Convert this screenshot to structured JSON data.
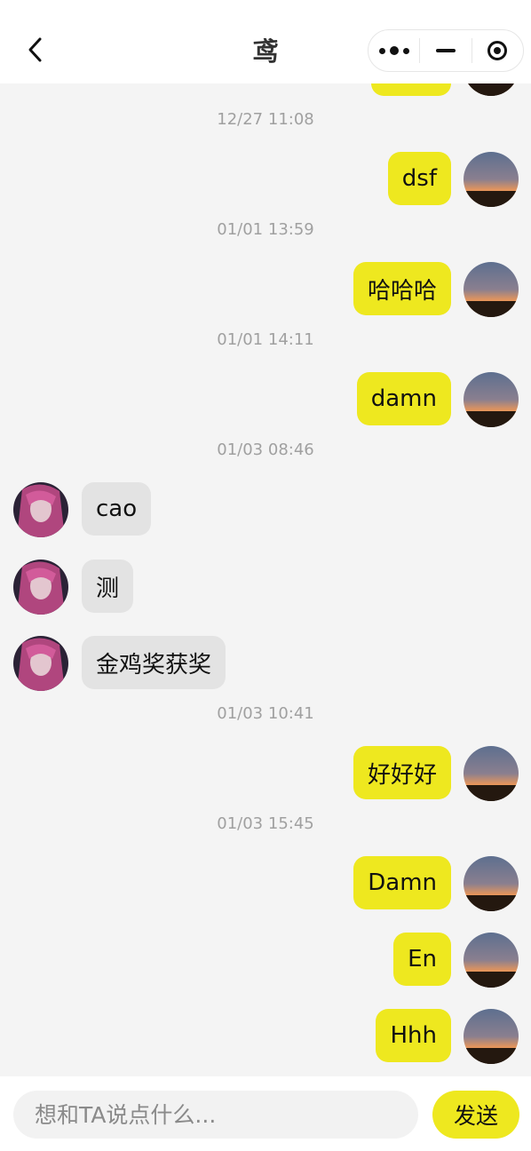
{
  "header": {
    "title": "鸢",
    "back_icon": "chevron-left-icon",
    "capsule": [
      "more-dots-icon",
      "minimize-icon",
      "close-target-icon"
    ]
  },
  "colors": {
    "my_bubble": "#eee81f",
    "other_bubble": "#e3e3e3",
    "timestamp": "#a0a0a0",
    "background": "#f4f4f4"
  },
  "messages": {
    "ts1": "12/27 11:08",
    "m1": "dsf",
    "ts2": "01/01 13:59",
    "m2": "哈哈哈",
    "ts3": "01/01 14:11",
    "m3": "damn",
    "ts4": "01/03 08:46",
    "m4": "cao",
    "m5": "测",
    "m6": "金鸡奖获奖",
    "ts5": "01/03 10:41",
    "m7": "好好好",
    "ts6": "01/03 15:45",
    "m8": "Damn",
    "m9": "En",
    "m10": "Hhh"
  },
  "composer": {
    "placeholder": "想和TA说点什么...",
    "send_label": "发送"
  }
}
